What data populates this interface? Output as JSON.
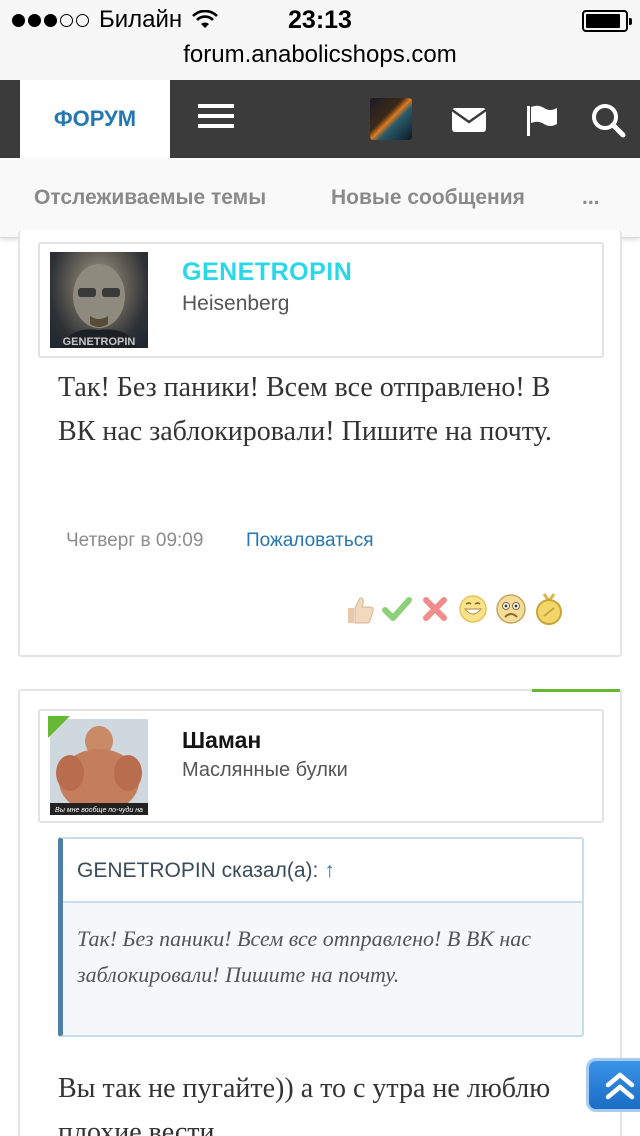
{
  "status_bar": {
    "carrier": "Билайн",
    "time": "23:13"
  },
  "url_bar": {
    "url": "forum.anabolicshops.com"
  },
  "nav": {
    "forum_tab": "ФОРУМ",
    "icons": [
      "menu-icon",
      "user-avatar",
      "mail-icon",
      "flag-icon",
      "search-icon"
    ]
  },
  "subnav": {
    "watched": "Отслеживаемые темы",
    "new_messages": "Новые сообщения",
    "more": "..."
  },
  "post1": {
    "username": "GENETROPIN",
    "user_title": "Heisenberg",
    "avatar_caption": "GENETROPIN",
    "message": "Так! Без паники! Всем все отправлено! В ВК нас заблокировали! Пишите на почту.",
    "date": "Четверг в 09:09",
    "report": "Пожаловаться",
    "ratings": [
      "thumbs-up-icon",
      "check-icon",
      "cross-icon",
      "grin-icon",
      "sad-icon",
      "medal-icon"
    ]
  },
  "post2": {
    "username": "Шаман",
    "user_title": "Маслянные булки",
    "avatar_caption": "Вы мне вообще по-чуди на",
    "quote_author": "GENETROPIN сказал(а):",
    "quote_arrow": "↑",
    "quote_text": "Так! Без паники! Всем все отправлено! В ВК нас заблокировали! Пишите на почту.",
    "message": "Вы так не пугайте)) а то с утра не люблю плохие вести"
  },
  "colors": {
    "nav_bg": "#3b3b3b",
    "link": "#2577b1",
    "username_accent": "#28d8e8",
    "online_green": "#66b832"
  }
}
